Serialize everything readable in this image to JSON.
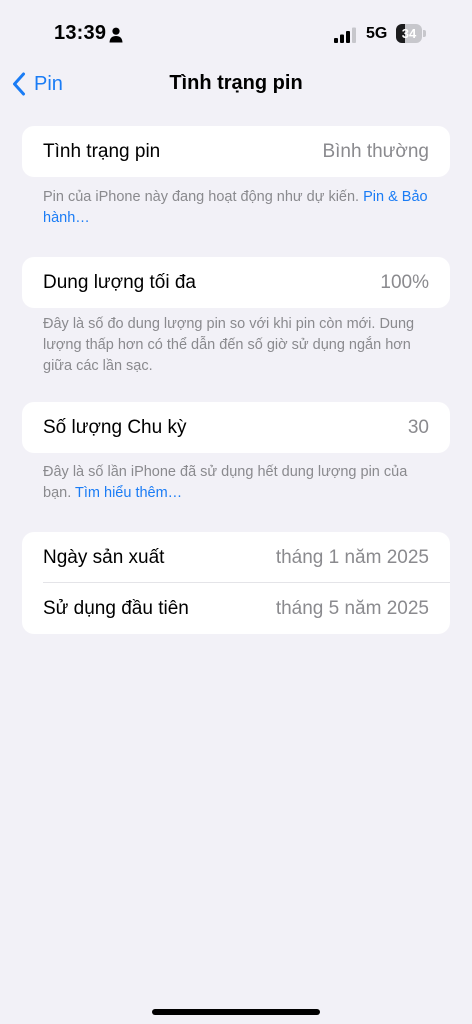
{
  "status_bar": {
    "time": "13:39",
    "network": "5G",
    "battery_level": "34",
    "battery_fraction": 0.34,
    "signal_bars_active": 3,
    "signal_bars_total": 4,
    "icons": [
      "person-icon",
      "cellular-signal-icon",
      "battery-icon"
    ]
  },
  "nav": {
    "back_label": "Pin",
    "title": "Tình trạng pin"
  },
  "health": {
    "label": "Tình trạng pin",
    "value": "Bình thường",
    "note": "Pin của iPhone này đang hoạt động như dự kiến.",
    "note_link": "Pin & Bảo hành…"
  },
  "capacity": {
    "label": "Dung lượng tối đa",
    "value": "100%",
    "note": "Đây là số đo dung lượng pin so với khi pin còn mới. Dung lượng thấp hơn có thể dẫn đến số giờ sử dụng ngắn hơn giữa các lần sạc."
  },
  "cycles": {
    "label": "Số lượng Chu kỳ",
    "value": "30",
    "note": "Đây là số lần iPhone đã sử dụng hết dung lượng pin của bạn.",
    "note_link": "Tìm hiểu thêm…"
  },
  "dates": {
    "manufacture_label": "Ngày sản xuất",
    "manufacture_value": "tháng 1 năm 2025",
    "first_use_label": "Sử dụng đầu tiên",
    "first_use_value": "tháng 5 năm 2025"
  },
  "colors": {
    "accent": "#1a7cf5",
    "background": "#f2f1f7",
    "secondary_text": "#8a8a8e"
  }
}
